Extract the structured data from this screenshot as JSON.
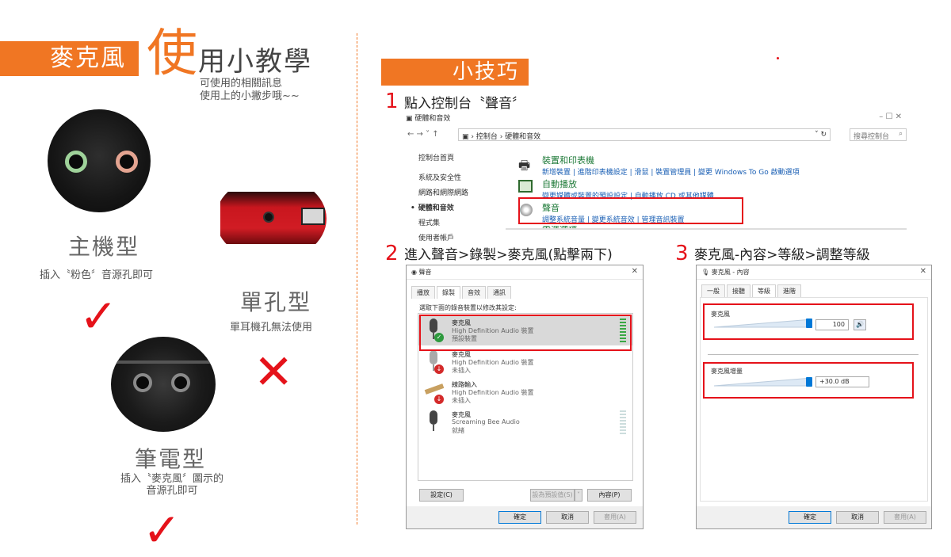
{
  "left": {
    "title_box": "麥克風",
    "title_big": "使",
    "title_rest": "用小教學",
    "subtitle_line1": "可使用的相關訊息",
    "subtitle_line2": "使用上的小撇步哦~~",
    "desktop": {
      "name": "主機型",
      "note": "插入〝粉色〞音源孔即可"
    },
    "single": {
      "name": "單孔型",
      "note": "單耳機孔無法使用"
    },
    "laptop": {
      "name": "筆電型",
      "note_line1": "插入〝麥克風〞圖示的",
      "note_line2": "音源孔即可"
    },
    "check_symbol": "✓",
    "cross_symbol": "✕",
    "accent_color": "#f07623",
    "mark_color": "#e5121a"
  },
  "tips": {
    "label": "小技巧",
    "step1": {
      "num": "1",
      "text": "點入控制台〝聲音〞"
    },
    "step2": {
      "num": "2",
      "text": "進入聲音>錄製>麥克風(點擊兩下)"
    },
    "step3": {
      "num": "3",
      "text": "麥克風-內容>等級>調整等級"
    }
  },
  "control_panel": {
    "window_title": "硬體和音效",
    "nav_arrows": "←  →  ˅  ↑",
    "breadcrumb": "› 控制台 › 硬體和音效",
    "search_placeholder": "搜尋控制台",
    "window_controls": "–   ☐   ✕",
    "nav": [
      "控制台首頁",
      "系統及安全性",
      "網路和網際網路",
      "硬體和音效",
      "程式集",
      "使用者帳戶"
    ],
    "sections": [
      {
        "title": "裝置和印表機",
        "links": "新增裝置 | 進階印表機設定 | 滑鼠 | 裝置管理員 | 變更 Windows To Go 啟動選項"
      },
      {
        "title": "自動播放",
        "links": "變更媒體或裝置的預設設定 | 自動播放 CD 或其他媒體"
      },
      {
        "title": "聲音",
        "links": "調整系統音量 | 變更系統音效 | 管理音訊裝置"
      },
      {
        "title": "電源選項",
        "links": ""
      }
    ]
  },
  "sound_dialog": {
    "title": "聲音",
    "tabs": [
      "播放",
      "錄製",
      "音效",
      "通訊"
    ],
    "active_tab": "錄製",
    "instruction": "選取下面的錄音裝置以修改其設定:",
    "devices": [
      {
        "name": "麥克風",
        "driver": "High Definition Audio 裝置",
        "status": "預設裝置"
      },
      {
        "name": "麥克風",
        "driver": "High Definition Audio 裝置",
        "status": "未插入"
      },
      {
        "name": "線路輸入",
        "driver": "High Definition Audio 裝置",
        "status": "未插入"
      },
      {
        "name": "麥克風",
        "driver": "Screaming Bee Audio",
        "status": "就緒"
      }
    ],
    "btn_configure": "設定(C)",
    "btn_set_default": "設為預設值(S)",
    "btn_properties": "內容(P)",
    "btn_ok": "確定",
    "btn_cancel": "取消",
    "btn_apply": "套用(A)"
  },
  "mic_dialog": {
    "title": "麥克風 - 內容",
    "tabs": [
      "一般",
      "接聽",
      "等級",
      "進階"
    ],
    "active_tab": "等級",
    "mic_label": "麥克風",
    "mic_value": "100",
    "boost_label": "麥克風增量",
    "boost_value": "+30.0 dB",
    "mic_level": 1.0,
    "boost_level": 1.0,
    "btn_ok": "確定",
    "btn_cancel": "取消",
    "btn_apply": "套用(A)"
  }
}
